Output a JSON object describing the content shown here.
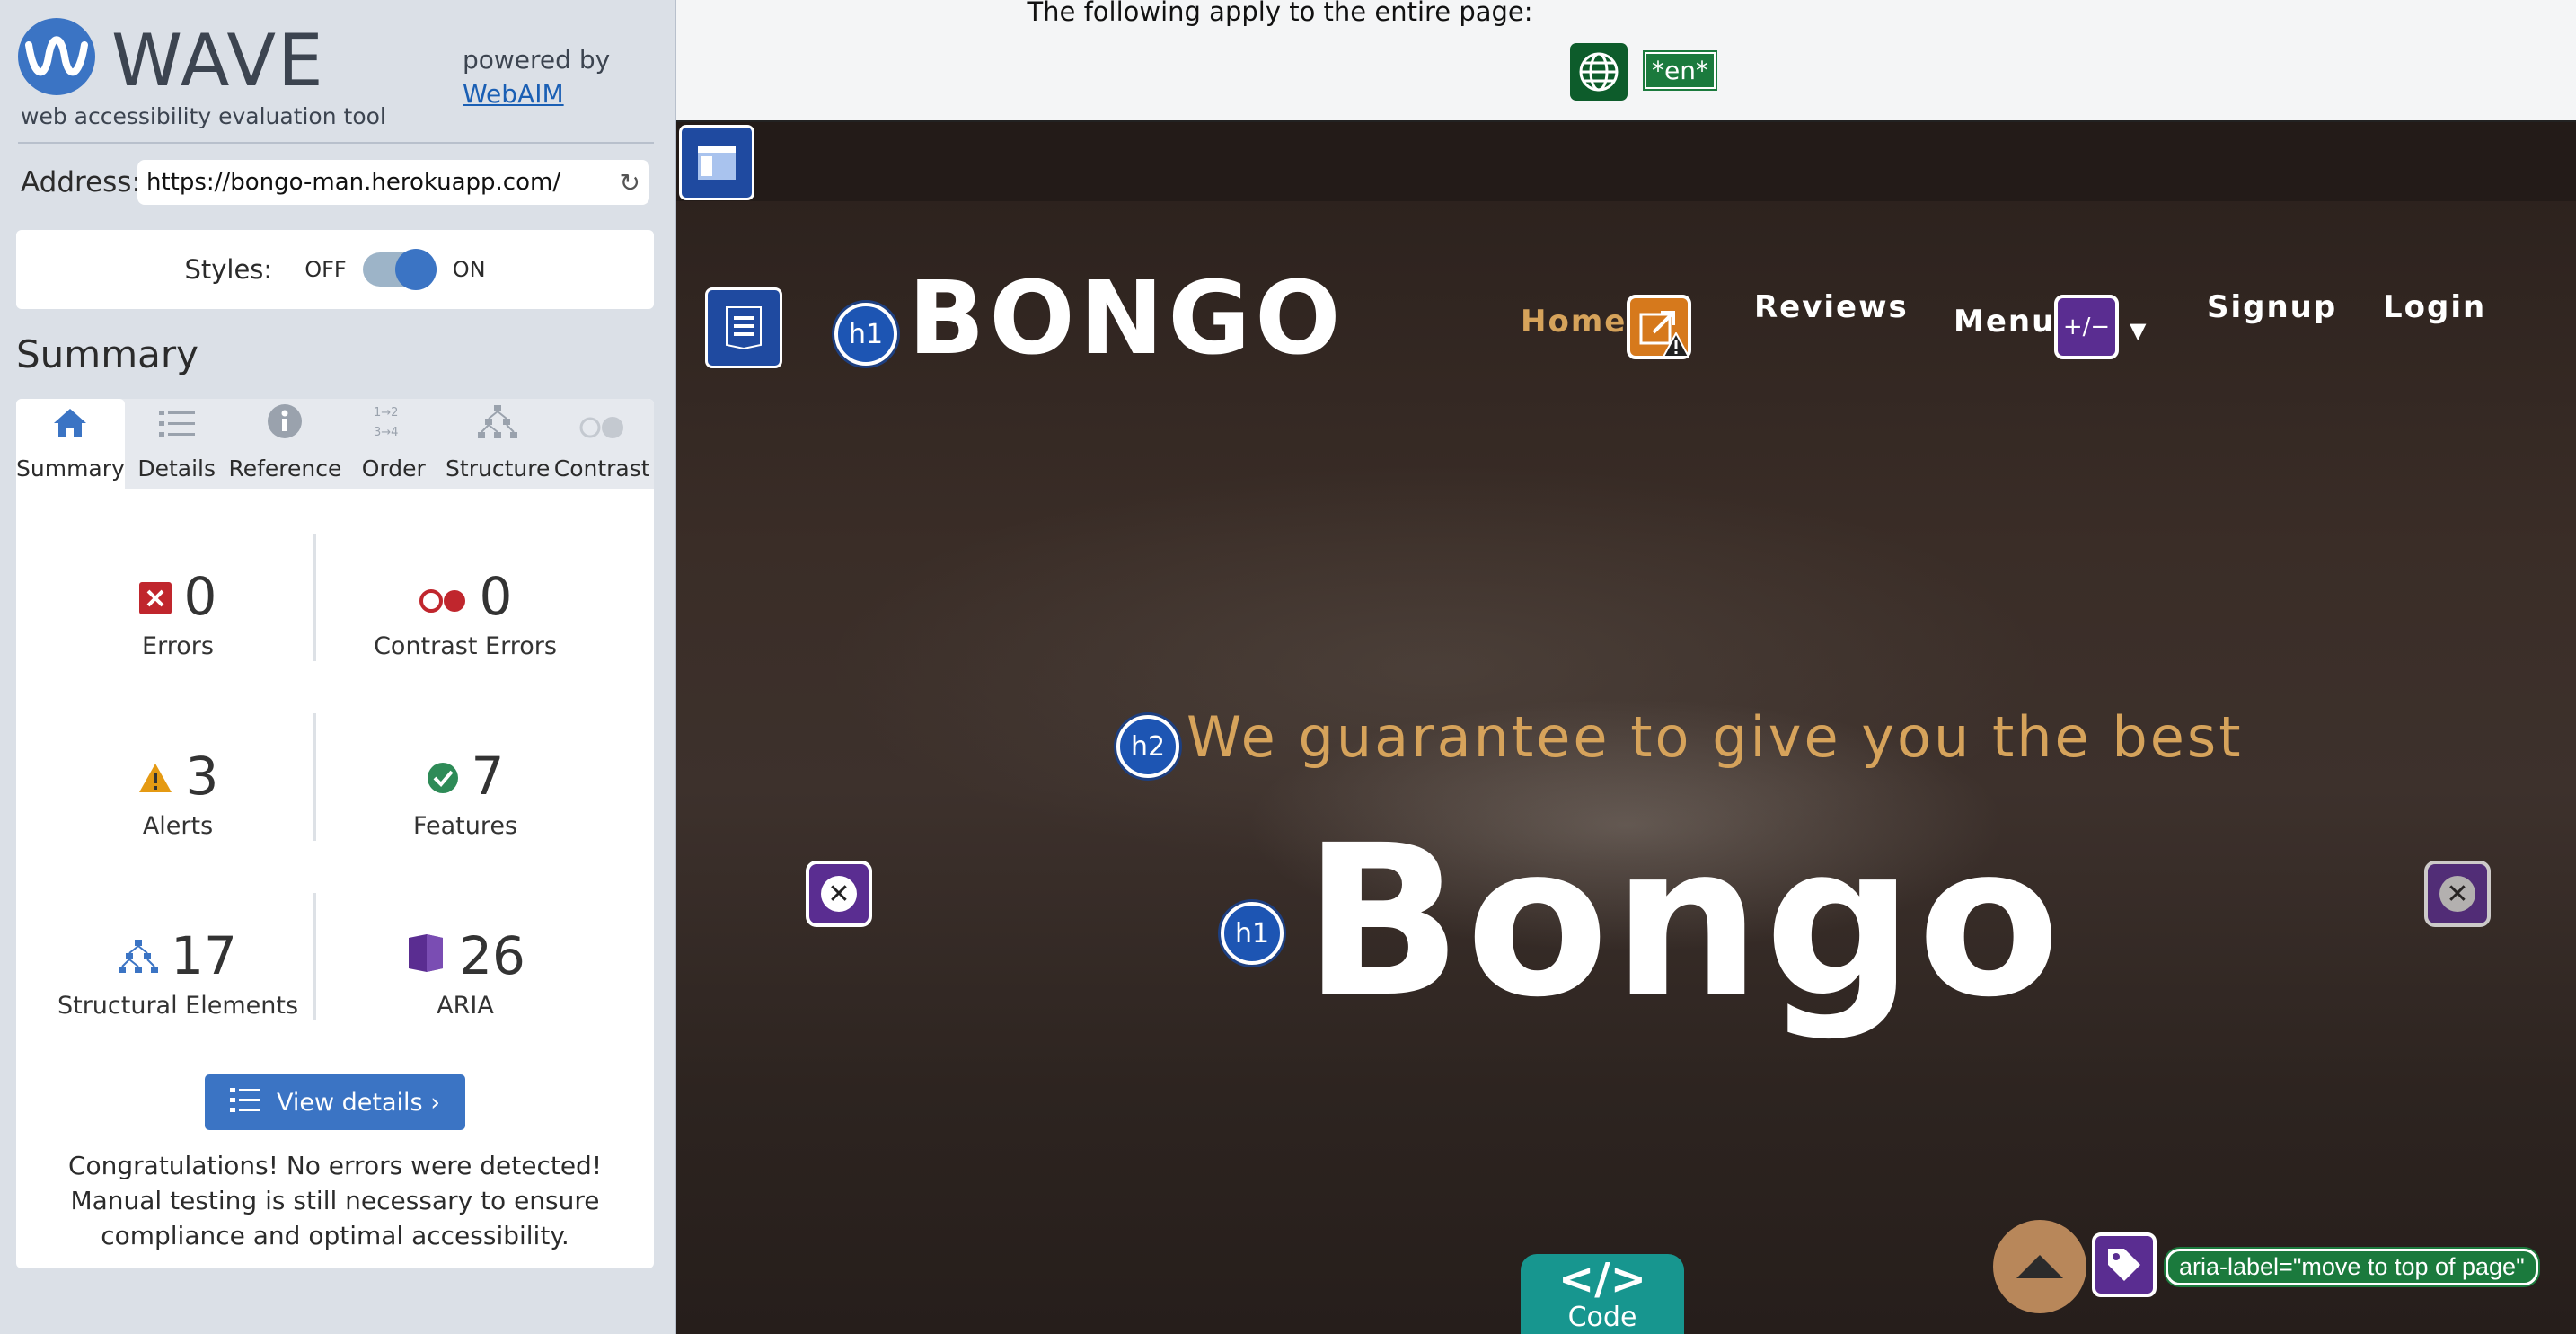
{
  "wave": {
    "logo_text": "WAVE",
    "subtitle": "web accessibility evaluation tool",
    "powered_by": "powered by",
    "webaim_link": "WebAIM",
    "address_label": "Address:",
    "address_value": "https://bongo-man.herokuapp.com/",
    "styles_label": "Styles:",
    "styles_off": "OFF",
    "styles_on": "ON",
    "summary_heading": "Summary",
    "tabs": [
      {
        "label": "Summary",
        "icon": "home-icon"
      },
      {
        "label": "Details",
        "icon": "list-icon"
      },
      {
        "label": "Reference",
        "icon": "info-icon"
      },
      {
        "label": "Order",
        "icon": "order-icon"
      },
      {
        "label": "Structure",
        "icon": "structure-icon"
      },
      {
        "label": "Contrast",
        "icon": "contrast-icon"
      }
    ],
    "stats": {
      "errors": {
        "count": "0",
        "label": "Errors"
      },
      "contrast_errors": {
        "count": "0",
        "label": "Contrast Errors"
      },
      "alerts": {
        "count": "3",
        "label": "Alerts"
      },
      "features": {
        "count": "7",
        "label": "Features"
      },
      "structural": {
        "count": "17",
        "label": "Structural Elements"
      },
      "aria": {
        "count": "26",
        "label": "ARIA"
      }
    },
    "view_details": "View details ›",
    "congrats": "Congratulations! No errors were detected! Manual testing is still necessary to ensure compliance and optimal accessibility."
  },
  "page_top": {
    "apply_text": "The following apply to the entire page:",
    "lang_badge": "*en*"
  },
  "site": {
    "brand": "BONGO",
    "nav": {
      "home": "Home",
      "reviews": "Reviews",
      "menu": "Menu",
      "signup": "Signup",
      "login": "Login"
    },
    "badges": {
      "h1": "h1",
      "h2": "h2",
      "menu_aria": "+/−"
    },
    "tagline": "We guarantee to give you the best",
    "hero": "Bongo",
    "code_tab": {
      "symbol": "</>",
      "label": "Code"
    },
    "aria_label_pill": "aria-label=\"move to top of page\""
  },
  "colors": {
    "wave_blue": "#3b74c4",
    "error_red": "#c0262d",
    "alert_orange": "#e59a13",
    "feature_green": "#2e8b57",
    "aria_purple": "#5a2d91",
    "site_accent": "#d6a35b"
  }
}
